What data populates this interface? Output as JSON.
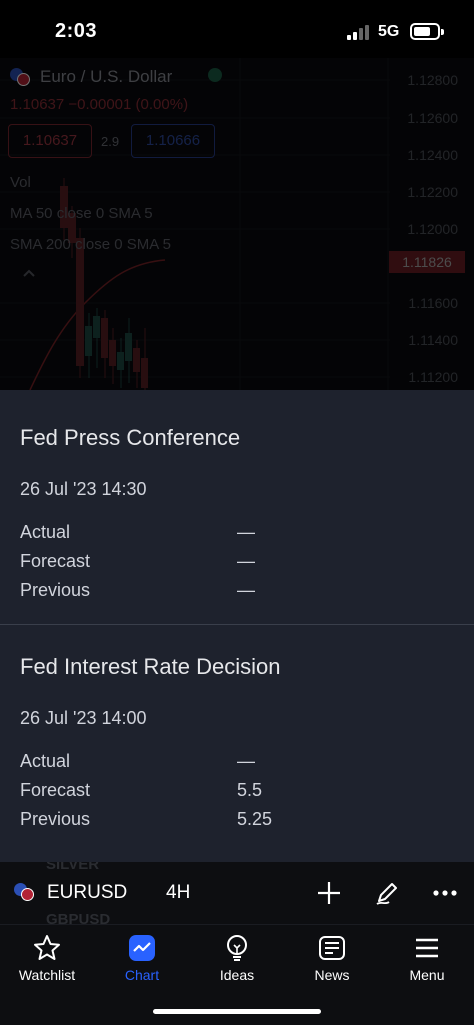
{
  "status_bar": {
    "time": "2:03",
    "network": "5G"
  },
  "chart": {
    "symbol_name": "Euro / U.S. Dollar",
    "price_line": "1.10637 −0.00001 (0.00%)",
    "bid": "1.10637",
    "spread": "2.9",
    "ask": "1.10666",
    "indicators": [
      "Vol",
      "MA 50 close 0 SMA 5",
      "SMA 200 close 0 SMA 5"
    ],
    "price_axis": [
      "1.12800",
      "1.12600",
      "1.12400",
      "1.12200",
      "1.12000",
      "1.11600",
      "1.11400",
      "1.11200"
    ],
    "current_price_tag": "1.11826",
    "colors": {
      "bearish": "#b23a45",
      "bullish": "#26a69a",
      "ma": "#b22f35"
    }
  },
  "events": [
    {
      "title": "Fed Press Conference",
      "datetime": "26 Jul '23 14:30",
      "rows": [
        {
          "label": "Actual",
          "value": "—"
        },
        {
          "label": "Forecast",
          "value": "—"
        },
        {
          "label": "Previous",
          "value": "—"
        }
      ]
    },
    {
      "title": "Fed Interest Rate Decision",
      "datetime": "26 Jul '23 14:00",
      "rows": [
        {
          "label": "Actual",
          "value": "—"
        },
        {
          "label": "Forecast",
          "value": "5.5"
        },
        {
          "label": "Previous",
          "value": "5.25"
        }
      ]
    }
  ],
  "ticker_bar": {
    "symbol": "EURUSD",
    "interval": "4H",
    "ghost_above": "SILVER",
    "ghost_below": "GBPUSD",
    "icons": [
      "plus-icon",
      "pen-icon",
      "more-icon"
    ]
  },
  "nav": {
    "items": [
      {
        "label": "Watchlist",
        "icon": "star-icon",
        "active": false
      },
      {
        "label": "Chart",
        "icon": "chart-icon",
        "active": true
      },
      {
        "label": "Ideas",
        "icon": "bulb-icon",
        "active": false
      },
      {
        "label": "News",
        "icon": "news-icon",
        "active": false
      },
      {
        "label": "Menu",
        "icon": "hamburger-icon",
        "active": false
      }
    ],
    "active_color": "#2962ff"
  },
  "theme": {
    "sheet_bg": "#1e222d",
    "text": "#d1d4dc"
  }
}
